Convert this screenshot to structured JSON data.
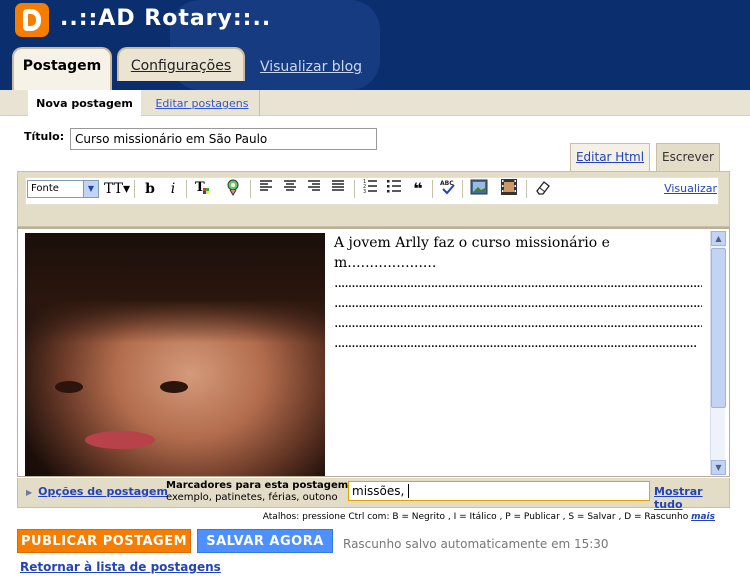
{
  "header": {
    "blog_title": "..::AD Rotary::..",
    "brand_color": "#f57d00",
    "bg_color": "#0a2e6e"
  },
  "tabs": [
    {
      "label": "Postagem",
      "active": true
    },
    {
      "label": "Configurações",
      "active": false
    },
    {
      "label": "Visualizar blog",
      "active": false
    }
  ],
  "subtabs": [
    {
      "label": "Nova postagem",
      "active": true
    },
    {
      "label": "Editar postagens",
      "active": false
    }
  ],
  "post": {
    "title_label": "Título:",
    "title_value": "Curso missionário em São Paulo",
    "body_text": "A jovem Arlly faz o curso missionário em....................",
    "body_dots": "................................................................................................................................................................................................................................................................................................"
  },
  "mode_tabs": {
    "html": "Editar Html",
    "compose": "Escrever"
  },
  "toolbar": {
    "font_label": "Fonte",
    "size_glyph": "TT",
    "bold": "b",
    "italic": "i",
    "preview": "Visualizar",
    "icons": [
      "text-color-icon",
      "link-icon",
      "align-left-icon",
      "align-center-icon",
      "align-right-icon",
      "justify-icon",
      "numbered-list-icon",
      "bullet-list-icon",
      "blockquote-icon",
      "spellcheck-icon",
      "image-icon",
      "video-icon",
      "clear-format-icon"
    ]
  },
  "labels": {
    "options_link": "Opções de postagem",
    "label_title": "Marcadores para esta postagem:",
    "label_hint": "exemplo, patinetes, férias, outono",
    "label_value": "missões, ",
    "show_all": "Mostrar tudo"
  },
  "shortcuts": {
    "text": "Atalhos: pressione Ctrl com: B = Negrito , I = Itálico , P = Publicar , S = Salvar , D = Rascunho",
    "more": "mais"
  },
  "actions": {
    "publish": "PUBLICAR POSTAGEM",
    "save": "SALVAR AGORA",
    "status": "Rascunho salvo automaticamente em 15:30",
    "back": "Retornar à lista de postagens"
  }
}
